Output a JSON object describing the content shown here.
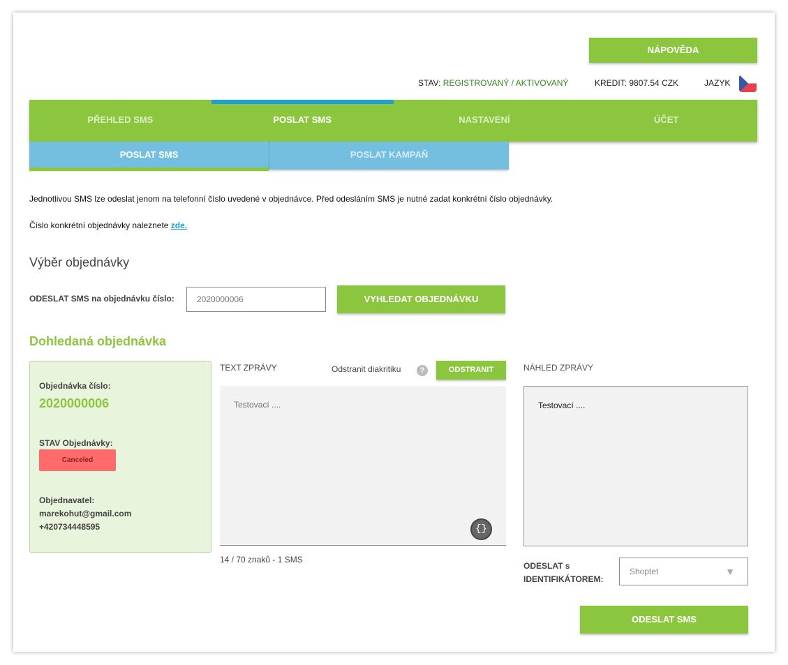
{
  "header": {
    "help_label": "NÁPOVĚDA",
    "status_label": "STAV:",
    "status_value": "REGISTROVANÝ / AKTIVOVANÝ",
    "credit": "KREDIT: 9807.54 CZK",
    "language_label": "JAZYK",
    "language_flag": "cz-flag-icon"
  },
  "main_nav": {
    "tabs": [
      {
        "label": "PŘEHLED SMS",
        "active": false
      },
      {
        "label": "POSLAT SMS",
        "active": true
      },
      {
        "label": "NASTAVENÍ",
        "active": false
      },
      {
        "label": "ÚČET",
        "active": false
      }
    ]
  },
  "sub_nav": {
    "tabs": [
      {
        "label": "POSLAT SMS",
        "active": true
      },
      {
        "label": "POSLAT KAMPAŇ",
        "active": false
      }
    ]
  },
  "info": {
    "line1": "Jednotlivou SMS lze odeslat jenom na telefonní číslo uvedené v objednávce. Před odesláním SMS je nutné zadat konkrétní číslo objednávky.",
    "line2_prefix": "Číslo konkrétní objednávky naleznete ",
    "line2_link": "zde."
  },
  "order_select": {
    "title": "Výběr objednávky",
    "label": "ODESLAT SMS na objednávku číslo:",
    "input_value": "2020000006",
    "search_button": "VYHLEDAT OBJEDNÁVKU"
  },
  "found_order": {
    "title": "Dohledaná objednávka",
    "number_label": "Objednávka číslo:",
    "number": "2020000006",
    "status_label": "STAV Objednávky:",
    "status": "Canceled",
    "customer_label": "Objednavatel:",
    "email": "marekohut@gmail.com",
    "phone": "+420734448595"
  },
  "message": {
    "label": "TEXT ZPRÁVY",
    "diacritics_label": "Odstranit diakritiku",
    "remove_button": "ODSTRANIT",
    "text": "Testovací ....",
    "counter": "14 / 70 znaků - 1 SMS",
    "insert_icon": "code-braces-icon"
  },
  "preview": {
    "label": "NÁHLED ZPRÁVY",
    "text": "Testovací ...."
  },
  "identifier": {
    "label_line1": "ODESLAT s",
    "label_line2": "IDENTIFIKÁTOREM:",
    "selected": "Shoptet"
  },
  "send_button": "ODESLAT SMS",
  "colors": {
    "green": "#8cc63f",
    "blue": "#74bfe0",
    "active_indicator": "#1a9fd9",
    "badge_red": "#ff6b6b"
  }
}
